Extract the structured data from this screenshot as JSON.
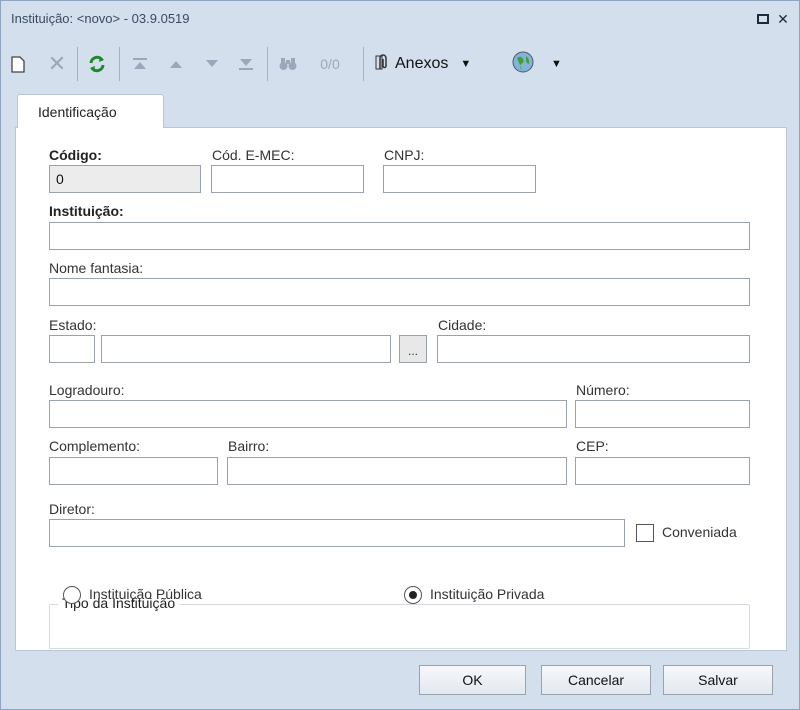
{
  "window": {
    "title": "Instituição: <novo> - 03.9.0519"
  },
  "toolbar": {
    "counter": "0/0",
    "anexos_label": "Anexos"
  },
  "tabs": [
    {
      "label": "Identificação"
    }
  ],
  "form": {
    "codigo": {
      "label": "Código:",
      "value": "0"
    },
    "cod_emec": {
      "label": "Cód. E-MEC:",
      "value": ""
    },
    "cnpj": {
      "label": "CNPJ:",
      "value": ""
    },
    "instituicao": {
      "label": "Instituição:",
      "value": ""
    },
    "nome_fantasia": {
      "label": "Nome fantasia:",
      "value": ""
    },
    "estado": {
      "label": "Estado:",
      "code_value": "",
      "name_value": "",
      "lookup_label": "..."
    },
    "cidade": {
      "label": "Cidade:",
      "value": ""
    },
    "logradouro": {
      "label": "Logradouro:",
      "value": ""
    },
    "numero": {
      "label": "Número:",
      "value": ""
    },
    "complemento": {
      "label": "Complemento:",
      "value": ""
    },
    "bairro": {
      "label": "Bairro:",
      "value": ""
    },
    "cep": {
      "label": "CEP:",
      "value": ""
    },
    "diretor": {
      "label": "Diretor:",
      "value": ""
    },
    "conveniada": {
      "label": "Conveniada",
      "checked": false
    },
    "tipo": {
      "legend": "Tipo da Instituição",
      "options": [
        {
          "label": "Instituição Pública",
          "selected": false
        },
        {
          "label": "Instituição Privada",
          "selected": true
        }
      ]
    }
  },
  "footer": {
    "ok_label": "OK",
    "cancel_label": "Cancelar",
    "save_label": "Salvar"
  }
}
